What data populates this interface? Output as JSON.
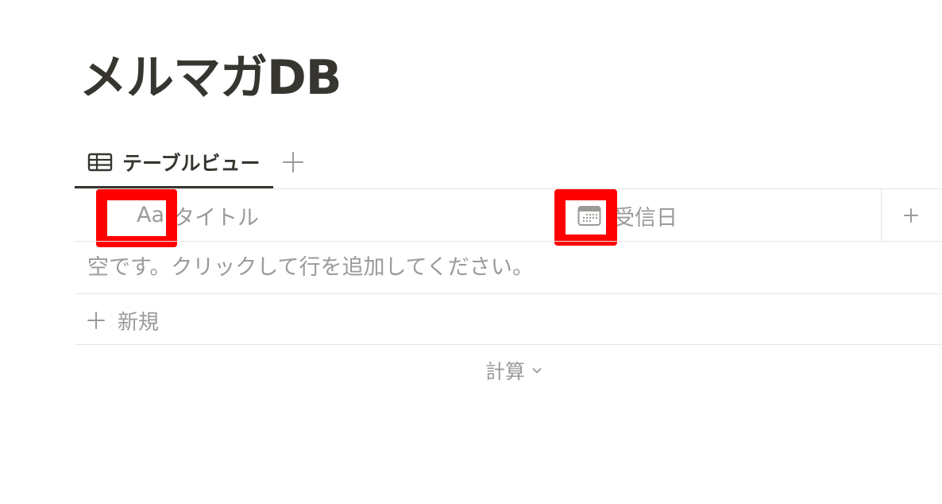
{
  "page": {
    "title": "メルマガDB"
  },
  "views": {
    "tabs": [
      {
        "label": "テーブルビュー",
        "icon": "table-icon"
      }
    ],
    "add_icon": "plus-icon"
  },
  "table": {
    "columns": [
      {
        "icon_text": "Aa",
        "icon": "text-property-icon",
        "label": "タイトル"
      },
      {
        "icon": "calendar-icon",
        "label": "受信日"
      }
    ],
    "add_column_icon": "plus-icon",
    "empty_message": "空です。クリックして行を追加してください。",
    "new_row_label": "新規",
    "calculate_label": "計算"
  },
  "highlights": {
    "color": "#ff0000",
    "targets": [
      "text-property-icon",
      "calendar-icon"
    ]
  }
}
